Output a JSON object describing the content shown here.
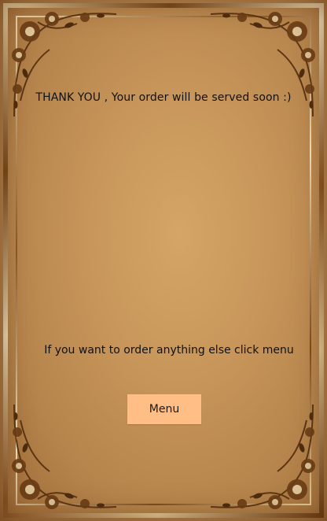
{
  "confirmation": {
    "message": "THANK YOU , Your order will be served soon :)"
  },
  "prompt": {
    "text": "If you want to order anything else click menu"
  },
  "menu_button": {
    "label": "Menu"
  },
  "colors": {
    "background": "#c8965a",
    "button": "#ffbe85",
    "text": "#111111"
  },
  "decoration": {
    "icon": "floral-gold-frame"
  }
}
